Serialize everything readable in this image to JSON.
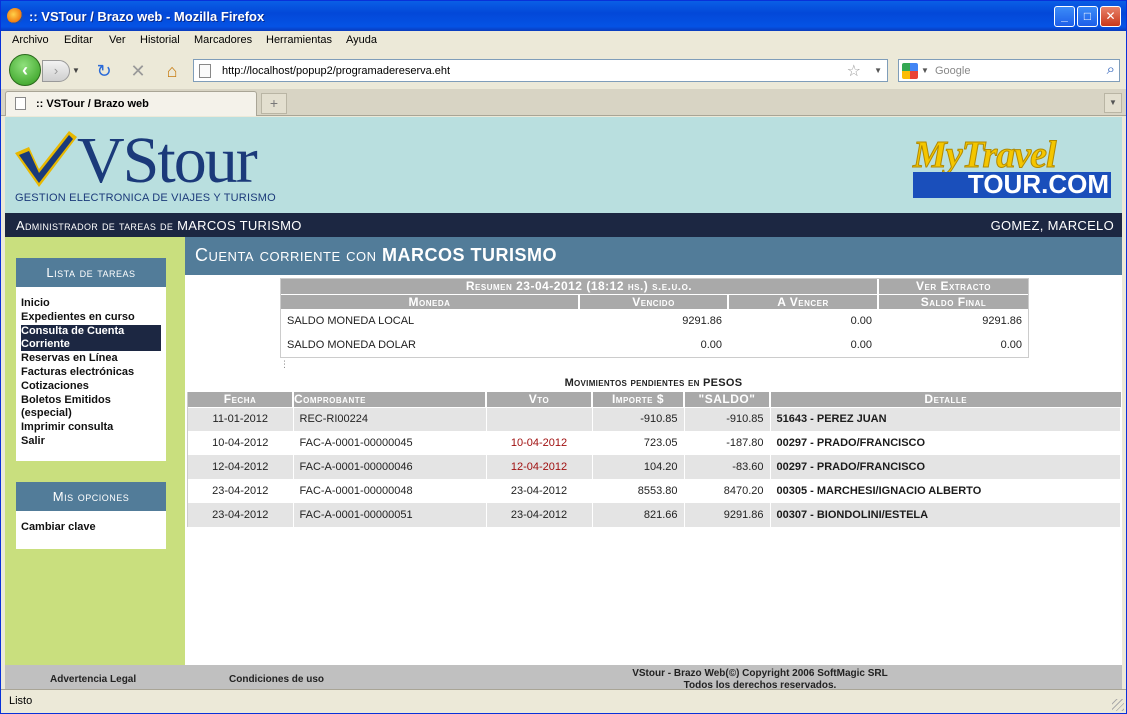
{
  "window": {
    "title": ":: VSTour / Brazo web - Mozilla Firefox",
    "buttons": {
      "minimize": "_",
      "maximize": "□",
      "close": "✕"
    }
  },
  "menu": [
    "Archivo",
    "Editar",
    "Ver",
    "Historial",
    "Marcadores",
    "Herramientas",
    "Ayuda"
  ],
  "navigation": {
    "url": "http://localhost/popup2/programadereserva.eht",
    "search_placeholder": "Google"
  },
  "tab": {
    "label": ":: VSTour / Brazo web",
    "new_tab": "+"
  },
  "header": {
    "logo_text": "VStour",
    "logo_subtitle": "GESTION ELECTRONICA DE VIAJES Y TURISMO",
    "partner_logo_top": "MyTravel",
    "partner_logo_bottom": "TOUR.COM"
  },
  "adminbar": {
    "left": "Administrador de tareas de MARCOS TURISMO",
    "right": "GOMEZ, MARCELO"
  },
  "sidebar": {
    "tasks_header": "Lista de tareas",
    "tasks": [
      "Inicio",
      "Expedientes en curso",
      "Consulta de Cuenta Corriente",
      "Reservas en Línea",
      "Facturas electrónicas",
      "Cotizaciones",
      "Boletos Emitidos (especial)",
      "Imprimir consulta",
      "Salir"
    ],
    "options_header": "Mis opciones",
    "options": [
      "Cambiar clave"
    ]
  },
  "main": {
    "title_prefix": "Cuenta corriente con ",
    "title_company": "MARCOS TURISMO",
    "resumen": {
      "title": "Resumen 23-04-2012 (18:12 hs.) s.e.u.o.",
      "extract_link": "Ver Extracto",
      "headers": [
        "Moneda",
        "Vencido",
        "A Vencer",
        "Saldo Final"
      ],
      "rows": [
        [
          "SALDO MONEDA LOCAL",
          "9291.86",
          "0.00",
          "9291.86"
        ],
        [
          "SALDO MONEDA DOLAR",
          "0.00",
          "0.00",
          "0.00"
        ]
      ]
    },
    "movements": {
      "title": "Movimientos pendientes en PESOS",
      "headers": [
        "Fecha",
        "Comprobante",
        "Vto",
        "Importe $",
        "\"SALDO\"",
        "Detalle"
      ],
      "rows": [
        [
          "11-01-2012",
          "REC-RI00224",
          "",
          "-910.85",
          "-910.85",
          "51643 - PEREZ JUAN"
        ],
        [
          "10-04-2012",
          "FAC-A-0001-00000045",
          "10-04-2012",
          "723.05",
          "-187.80",
          "00297 - PRADO/FRANCISCO"
        ],
        [
          "12-04-2012",
          "FAC-A-0001-00000046",
          "12-04-2012",
          "104.20",
          "-83.60",
          "00297 - PRADO/FRANCISCO"
        ],
        [
          "23-04-2012",
          "FAC-A-0001-00000048",
          "23-04-2012",
          "8553.80",
          "8470.20",
          "00305 - MARCHESI/IGNACIO ALBERTO"
        ],
        [
          "23-04-2012",
          "FAC-A-0001-00000051",
          "23-04-2012",
          "821.66",
          "9291.86",
          "00307 - BIONDOLINI/ESTELA"
        ]
      ],
      "overdue_rows": [
        1,
        2
      ]
    }
  },
  "footer": {
    "legal": "Advertencia Legal",
    "terms": "Condiciones de uso",
    "copyright_line1": "VStour - Brazo Web(©) Copyright 2006 SoftMagic SRL",
    "copyright_line2": "Todos los derechos reservados."
  },
  "status": "Listo",
  "colors": {
    "sidebar_bg": "#c9df7e",
    "header_blue": "#527c99",
    "dark_bar": "#1c2742",
    "overdue": "#a01010"
  }
}
